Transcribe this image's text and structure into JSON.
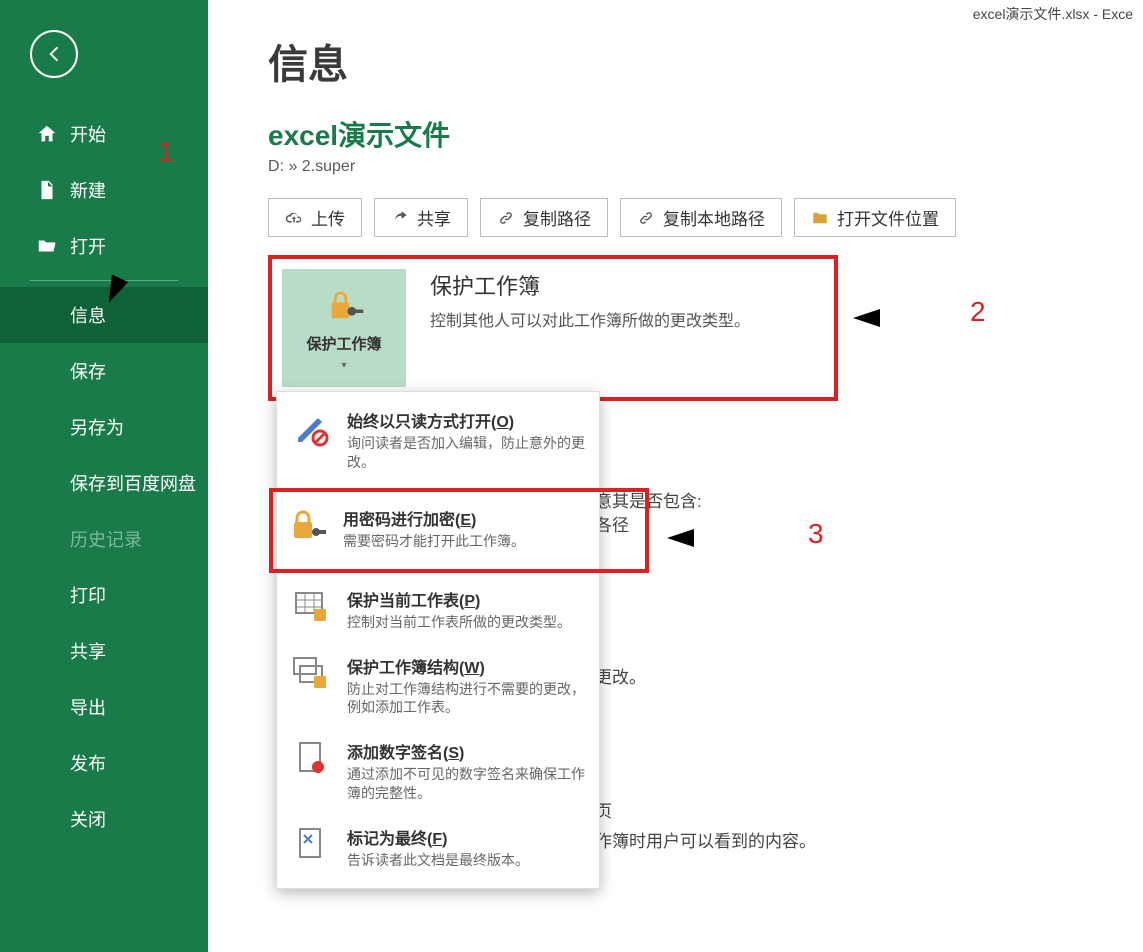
{
  "window_title": "excel演示文件.xlsx  -  Exce",
  "sidebar": {
    "start": "开始",
    "new": "新建",
    "open": "打开",
    "info": "信息",
    "save": "保存",
    "save_as": "另存为",
    "save_baidu": "保存到百度网盘",
    "history": "历史记录",
    "print": "打印",
    "share": "共享",
    "export": "导出",
    "publish": "发布",
    "close": "关闭"
  },
  "page_title": "信息",
  "file_title": "excel演示文件",
  "file_path": "D: » 2.super",
  "toolbar": {
    "upload": "上传",
    "share": "共享",
    "copy_path": "复制路径",
    "copy_local_path": "复制本地路径",
    "open_file_location": "打开文件位置"
  },
  "protect": {
    "tile_label": "保护工作簿",
    "title": "保护工作簿",
    "desc": "控制其他人可以对此工作簿所做的更改类型。"
  },
  "dropdown": [
    {
      "title_pre": "始终以只读方式打开(",
      "hotkey": "O",
      "title_post": ")",
      "desc": "询问读者是否加入编辑，防止意外的更改。"
    },
    {
      "title_pre": "用密码进行加密(",
      "hotkey": "E",
      "title_post": ")",
      "desc": "需要密码才能打开此工作簿。"
    },
    {
      "title_pre": "保护当前工作表(",
      "hotkey": "P",
      "title_post": ")",
      "desc": "控制对当前工作表所做的更改类型。"
    },
    {
      "title_pre": "保护工作簿结构(",
      "hotkey": "W",
      "title_post": ")",
      "desc": "防止对工作簿结构进行不需要的更改，例如添加工作表。"
    },
    {
      "title_pre": "添加数字签名(",
      "hotkey": "S",
      "title_post": ")",
      "desc": "通过添加不可见的数字签名来确保工作簿的完整性。"
    },
    {
      "title_pre": "标记为最终(",
      "hotkey": "F",
      "title_post": ")",
      "desc": "告诉读者此文档是最终版本。"
    }
  ],
  "fragments": {
    "f1": "意其是否包含:",
    "f2": "各径",
    "f3": "更改。",
    "f4": "页",
    "f5": "作簿时用户可以看到的内容。"
  },
  "annotations": {
    "n1": "1",
    "n2": "2",
    "n3": "3"
  }
}
